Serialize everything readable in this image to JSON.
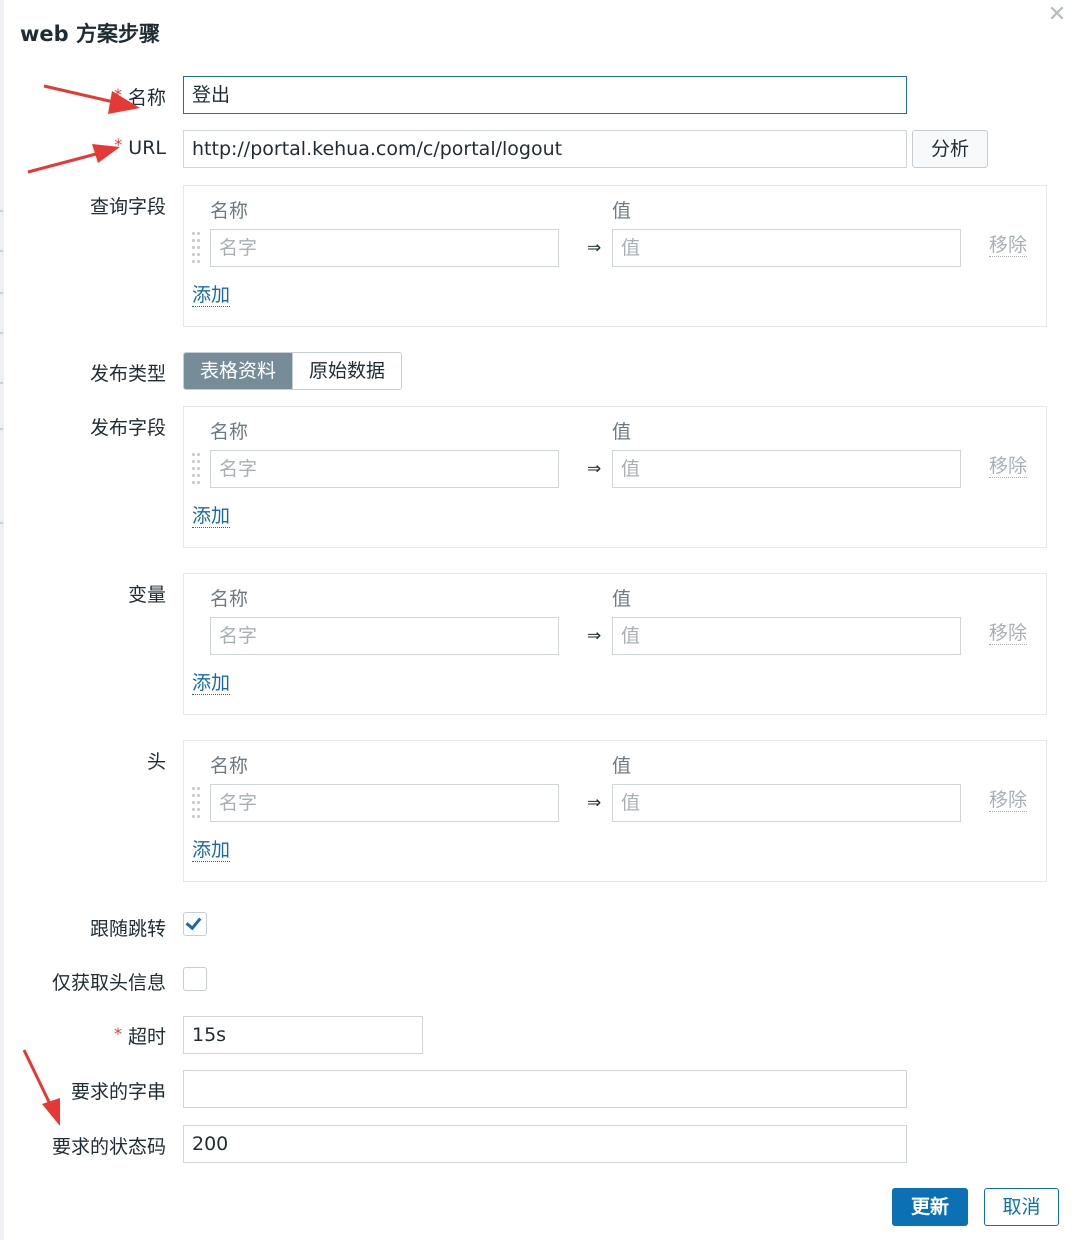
{
  "dialog": {
    "title": "web 方案步骤",
    "close_icon": "close-icon"
  },
  "form": {
    "name": {
      "label": "名称",
      "required": "*",
      "value": "登出"
    },
    "url": {
      "label": "URL",
      "required": "*",
      "value": "http://portal.kehua.com/c/portal/logout",
      "parse_button": "分析"
    },
    "query_fields": {
      "label": "查询字段",
      "col_name": "名称",
      "col_value": "值",
      "name_placeholder": "名字",
      "value_placeholder": "值",
      "arrow": "⇒",
      "remove": "移除",
      "add": "添加"
    },
    "post_type": {
      "label": "发布类型",
      "options": [
        "表格资料",
        "原始数据"
      ],
      "selected": "表格资料"
    },
    "post_fields": {
      "label": "发布字段",
      "col_name": "名称",
      "col_value": "值",
      "name_placeholder": "名字",
      "value_placeholder": "值",
      "arrow": "⇒",
      "remove": "移除",
      "add": "添加"
    },
    "variables": {
      "label": "变量",
      "col_name": "名称",
      "col_value": "值",
      "name_placeholder": "名字",
      "value_placeholder": "值",
      "arrow": "⇒",
      "remove": "移除",
      "add": "添加"
    },
    "headers": {
      "label": "头",
      "col_name": "名称",
      "col_value": "值",
      "name_placeholder": "名字",
      "value_placeholder": "值",
      "arrow": "⇒",
      "remove": "移除",
      "add": "添加"
    },
    "follow_redirects": {
      "label": "跟随跳转",
      "checked": true
    },
    "retrieve_headers_only": {
      "label": "仅获取头信息",
      "checked": false
    },
    "timeout": {
      "label": "超时",
      "required": "*",
      "value": "15s"
    },
    "required_string": {
      "label": "要求的字串",
      "value": ""
    },
    "required_status_codes": {
      "label": "要求的状态码",
      "value": "200"
    }
  },
  "footer": {
    "update_button": "更新",
    "cancel_button": "取消"
  },
  "colors": {
    "primary": "#0b70b4",
    "link": "#1a6aa8",
    "segment_active": "#768d99",
    "required": "#e53935",
    "annotation_arrow": "#e53935"
  }
}
